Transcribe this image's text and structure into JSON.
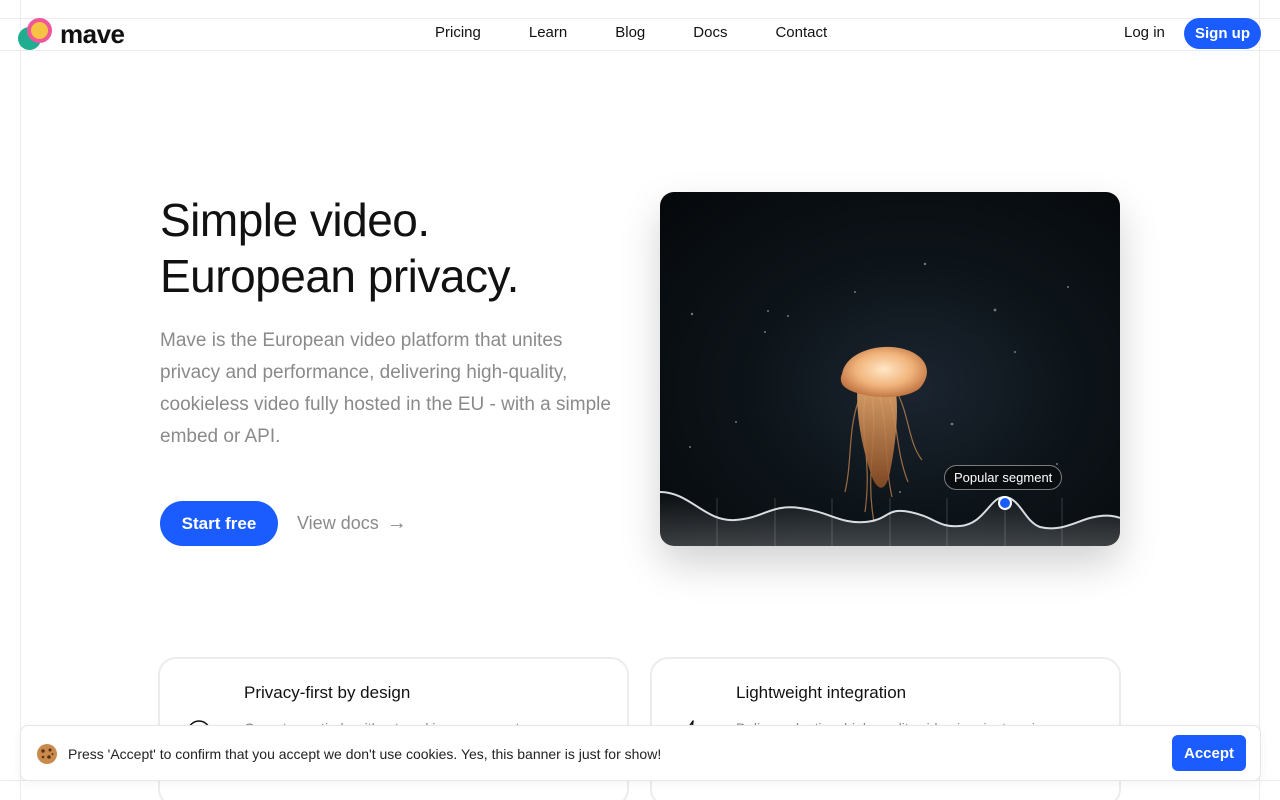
{
  "brand": {
    "name": "mave"
  },
  "nav": {
    "items": [
      "Pricing",
      "Learn",
      "Blog",
      "Docs",
      "Contact"
    ],
    "login": "Log in",
    "signup": "Sign up"
  },
  "hero": {
    "title_line1": "Simple video.",
    "title_line2": "European privacy.",
    "description": "Mave is the European video platform that unites privacy and performance, delivering high-quality, cookieless video fully hosted in the EU - with a simple embed or API.",
    "cta_primary": "Start free",
    "cta_secondary": "View docs"
  },
  "video": {
    "segment_label": "Popular segment"
  },
  "features": [
    {
      "title": "Privacy-first by design",
      "description": "Operates entirely without cookies or consent",
      "icon": "shield-icon"
    },
    {
      "title": "Lightweight integration",
      "description": "Deliver adaptive, high-quality video in minutes via a",
      "icon": "bolt-icon"
    }
  ],
  "cookie_banner": {
    "icon": "cookie-icon",
    "text": "Press 'Accept' to confirm that you accept we don't use cookies. Yes, this banner is just for show!",
    "accept": "Accept"
  },
  "colors": {
    "accent": "#1a5cff",
    "logo_teal": "#1fae8f",
    "logo_pink": "#f0569a",
    "logo_yellow": "#f6c343",
    "muted_text": "#8a8a8a"
  }
}
